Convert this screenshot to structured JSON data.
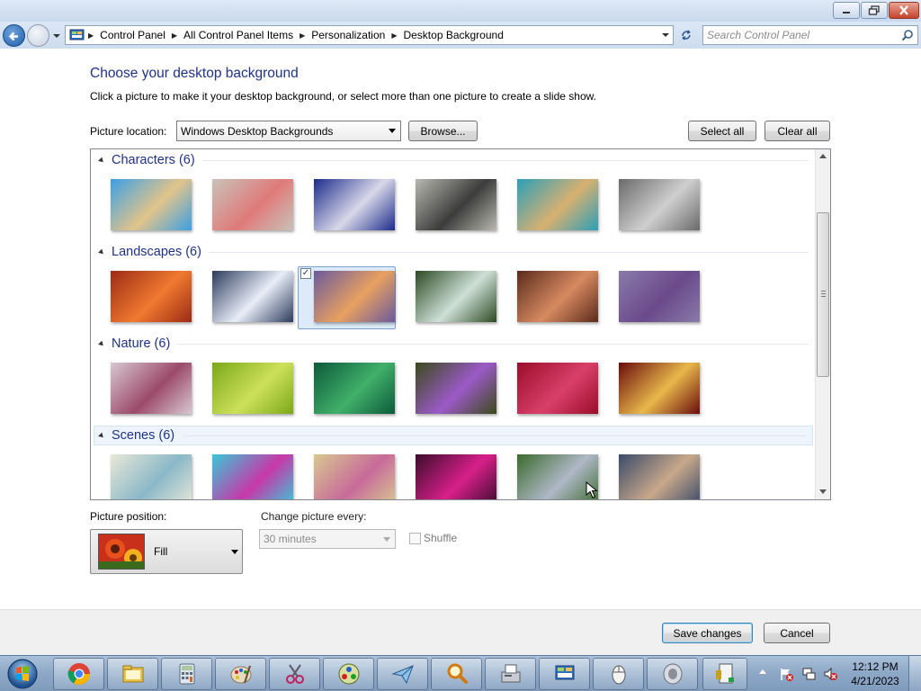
{
  "window": {
    "buttons": [
      "minimize",
      "maximize",
      "close"
    ]
  },
  "address_bar": {
    "breadcrumb": [
      "Control Panel",
      "All Control Panel Items",
      "Personalization",
      "Desktop Background"
    ],
    "search_placeholder": "Search Control Panel"
  },
  "main": {
    "title": "Choose your desktop background",
    "description": "Click a picture to make it your desktop background, or select more than one picture to create a slide show.",
    "picture_location_label": "Picture location:",
    "picture_location_value": "Windows Desktop Backgrounds",
    "browse_label": "Browse...",
    "select_all_label": "Select all",
    "clear_all_label": "Clear all"
  },
  "gallery": {
    "groups": [
      {
        "label": "Characters (6)",
        "colors": [
          [
            "#3aa0e4",
            "#e2c48a"
          ],
          [
            "#c8c2b8",
            "#e07a7a"
          ],
          [
            "#1c2b8c",
            "#d8d8e8"
          ],
          [
            "#b8b8b0",
            "#3c3c3c"
          ],
          [
            "#2aa0b8",
            "#d8b070"
          ],
          [
            "#6a6a6a",
            "#cfcfcf"
          ]
        ]
      },
      {
        "label": "Landscapes (6)",
        "colors": [
          [
            "#9c2a14",
            "#f07a30"
          ],
          [
            "#2c3a5c",
            "#e8eef8"
          ],
          [
            "#6a5a9c",
            "#e8a060"
          ],
          [
            "#2c4a22",
            "#cfe0d8"
          ],
          [
            "#5a2a1c",
            "#d88a60"
          ],
          [
            "#8a7aa8",
            "#6a4a8c"
          ]
        ],
        "selected_index": 2
      },
      {
        "label": "Nature (6)",
        "colors": [
          [
            "#d8c8d0",
            "#9c4a6a"
          ],
          [
            "#7aa818",
            "#cde05a"
          ],
          [
            "#0c5a3a",
            "#40b06a"
          ],
          [
            "#3a4a1a",
            "#9c5ac8"
          ],
          [
            "#9c0c2a",
            "#d8406a"
          ],
          [
            "#6a0c0c",
            "#e8b84a"
          ]
        ]
      },
      {
        "label": "Scenes (6)",
        "colors": [
          [
            "#e8e8d8",
            "#8ab8c8"
          ],
          [
            "#38c8d8",
            "#c838a8"
          ],
          [
            "#d8c890",
            "#c86a9a"
          ],
          [
            "#3a0c2c",
            "#d8208a"
          ],
          [
            "#3a6a2c",
            "#b0b8c8"
          ],
          [
            "#3a4a6a",
            "#c8a88a"
          ]
        ]
      }
    ]
  },
  "settings": {
    "position_label": "Picture position:",
    "position_value": "Fill",
    "interval_label": "Change picture every:",
    "interval_value": "30 minutes",
    "shuffle_label": "Shuffle"
  },
  "footer": {
    "save_label": "Save changes",
    "cancel_label": "Cancel"
  },
  "taskbar": {
    "apps": [
      "chrome-icon",
      "folder-icon",
      "calculator-icon",
      "paint-icon",
      "snipping-tool-icon",
      "game-icon",
      "mail-send-icon",
      "magnifier-icon",
      "fax-icon",
      "control-panel-icon",
      "mouse-icon",
      "speaker-icon"
    ],
    "time": "12:12 PM",
    "date": "4/21/2023"
  }
}
